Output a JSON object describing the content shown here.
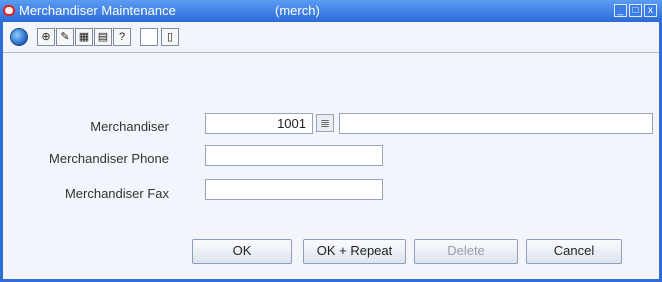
{
  "window": {
    "title": "Merchandiser Maintenance",
    "subtitle": "(merch)",
    "controls": {
      "minimize": "_",
      "maximize": "□",
      "close": "x"
    }
  },
  "toolbar": {
    "icons": [
      "globe-icon",
      "help-circle-icon",
      "notes-icon",
      "calendar-icon",
      "memo-icon",
      "question-icon",
      "blank-icon",
      "document-icon"
    ]
  },
  "form": {
    "merchandiser": {
      "label": "Merchandiser",
      "value": "1001",
      "description": ""
    },
    "phone": {
      "label": "Merchandiser Phone",
      "value": ""
    },
    "fax": {
      "label": "Merchandiser Fax",
      "value": ""
    }
  },
  "buttons": {
    "ok": "OK",
    "ok_repeat": "OK + Repeat",
    "delete": "Delete",
    "cancel": "Cancel"
  },
  "colors": {
    "titlebar": "#2c6ad8",
    "background": "#f2f5fb"
  }
}
